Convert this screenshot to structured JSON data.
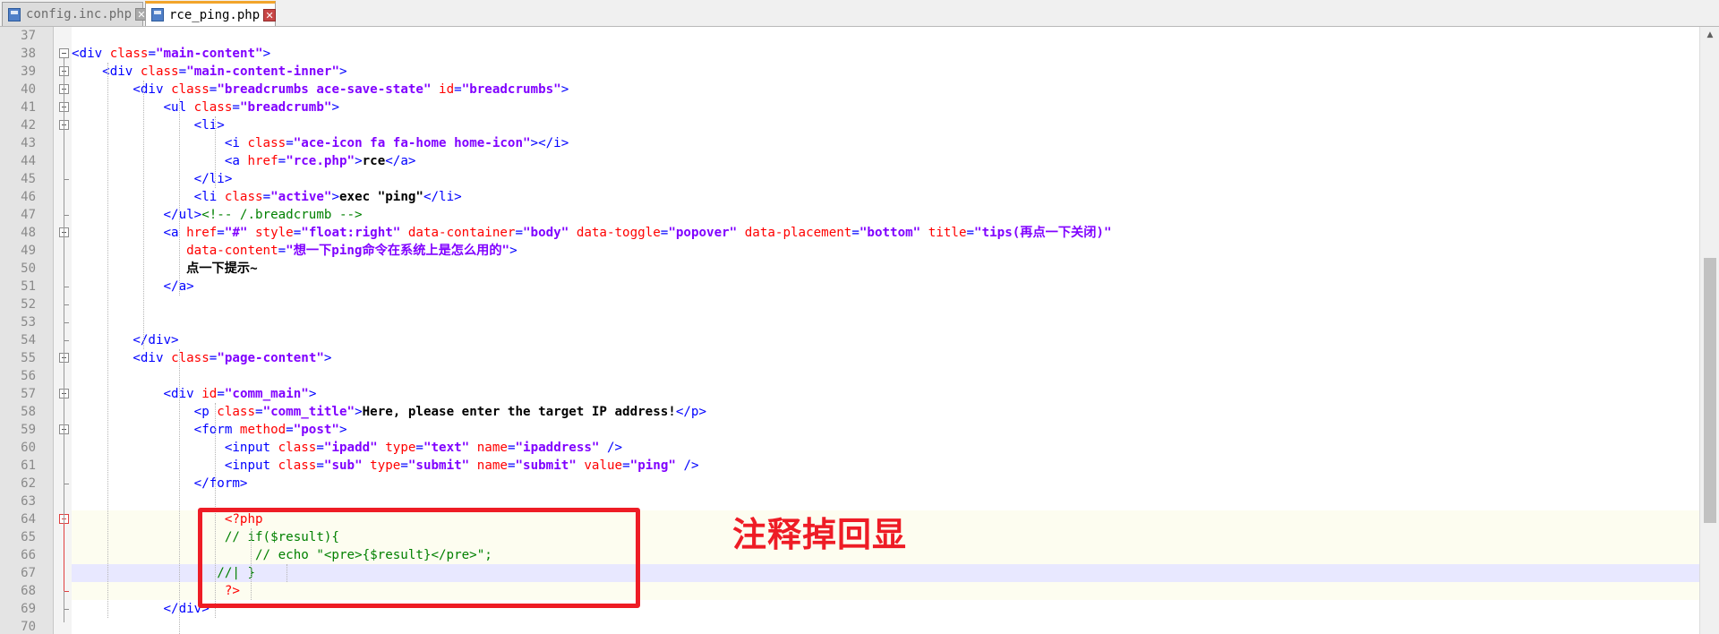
{
  "tabs": [
    {
      "label": "config.inc.php",
      "active": false
    },
    {
      "label": "rce_ping.php",
      "active": true
    }
  ],
  "editor": {
    "lines": [
      {
        "no": "37",
        "segs": []
      },
      {
        "no": "38",
        "segs": [
          [
            "tag",
            "<div "
          ],
          [
            "attr",
            "class"
          ],
          [
            "tag",
            "="
          ],
          [
            "val",
            "\"main-content\""
          ],
          [
            "tag",
            ">"
          ]
        ]
      },
      {
        "no": "39",
        "segs": [
          [
            "sp",
            "    "
          ],
          [
            "tag",
            "<div "
          ],
          [
            "attr",
            "class"
          ],
          [
            "tag",
            "="
          ],
          [
            "val",
            "\"main-content-inner\""
          ],
          [
            "tag",
            ">"
          ]
        ]
      },
      {
        "no": "40",
        "segs": [
          [
            "sp",
            "        "
          ],
          [
            "tag",
            "<div "
          ],
          [
            "attr",
            "class"
          ],
          [
            "tag",
            "="
          ],
          [
            "val",
            "\"breadcrumbs ace-save-state\""
          ],
          [
            "tag",
            " "
          ],
          [
            "attr",
            "id"
          ],
          [
            "tag",
            "="
          ],
          [
            "val",
            "\"breadcrumbs\""
          ],
          [
            "tag",
            ">"
          ]
        ]
      },
      {
        "no": "41",
        "segs": [
          [
            "sp",
            "            "
          ],
          [
            "tag",
            "<ul "
          ],
          [
            "attr",
            "class"
          ],
          [
            "tag",
            "="
          ],
          [
            "val",
            "\"breadcrumb\""
          ],
          [
            "tag",
            ">"
          ]
        ]
      },
      {
        "no": "42",
        "segs": [
          [
            "sp",
            "                "
          ],
          [
            "tag",
            "<li>"
          ]
        ]
      },
      {
        "no": "43",
        "segs": [
          [
            "sp",
            "                    "
          ],
          [
            "tag",
            "<i "
          ],
          [
            "attr",
            "class"
          ],
          [
            "tag",
            "="
          ],
          [
            "val",
            "\"ace-icon fa fa-home home-icon\""
          ],
          [
            "tag",
            "></i>"
          ]
        ]
      },
      {
        "no": "44",
        "segs": [
          [
            "sp",
            "                    "
          ],
          [
            "tag",
            "<a "
          ],
          [
            "attr",
            "href"
          ],
          [
            "tag",
            "="
          ],
          [
            "val",
            "\"rce.php\""
          ],
          [
            "tag",
            ">"
          ],
          [
            "txt",
            "rce"
          ],
          [
            "tag",
            "</a>"
          ]
        ]
      },
      {
        "no": "45",
        "segs": [
          [
            "sp",
            "                "
          ],
          [
            "tag",
            "</li>"
          ]
        ]
      },
      {
        "no": "46",
        "segs": [
          [
            "sp",
            "                "
          ],
          [
            "tag",
            "<li "
          ],
          [
            "attr",
            "class"
          ],
          [
            "tag",
            "="
          ],
          [
            "val",
            "\"active\""
          ],
          [
            "tag",
            ">"
          ],
          [
            "txt",
            "exec \"ping\""
          ],
          [
            "tag",
            "</li>"
          ]
        ]
      },
      {
        "no": "47",
        "segs": [
          [
            "sp",
            "            "
          ],
          [
            "tag",
            "</ul>"
          ],
          [
            "cmt",
            "<!-- /.breadcrumb -->"
          ]
        ]
      },
      {
        "no": "48",
        "segs": [
          [
            "sp",
            "            "
          ],
          [
            "tag",
            "<a "
          ],
          [
            "attr",
            "href"
          ],
          [
            "tag",
            "="
          ],
          [
            "val",
            "\"#\""
          ],
          [
            "tag",
            " "
          ],
          [
            "attr",
            "style"
          ],
          [
            "tag",
            "="
          ],
          [
            "val",
            "\"float:right\""
          ],
          [
            "tag",
            " "
          ],
          [
            "attr",
            "data-container"
          ],
          [
            "tag",
            "="
          ],
          [
            "val",
            "\"body\""
          ],
          [
            "tag",
            " "
          ],
          [
            "attr",
            "data-toggle"
          ],
          [
            "tag",
            "="
          ],
          [
            "val",
            "\"popover\""
          ],
          [
            "tag",
            " "
          ],
          [
            "attr",
            "data-placement"
          ],
          [
            "tag",
            "="
          ],
          [
            "val",
            "\"bottom\""
          ],
          [
            "tag",
            " "
          ],
          [
            "attr",
            "title"
          ],
          [
            "tag",
            "="
          ],
          [
            "val",
            "\"tips(再点一下关闭)\""
          ]
        ]
      },
      {
        "no": "49",
        "segs": [
          [
            "sp",
            "               "
          ],
          [
            "attr",
            "data-content"
          ],
          [
            "tag",
            "="
          ],
          [
            "val",
            "\"想一下ping命令在系统上是怎么用的\""
          ],
          [
            "tag",
            ">"
          ]
        ]
      },
      {
        "no": "50",
        "segs": [
          [
            "sp",
            "               "
          ],
          [
            "txt",
            "点一下提示~"
          ]
        ]
      },
      {
        "no": "51",
        "segs": [
          [
            "sp",
            "            "
          ],
          [
            "tag",
            "</a>"
          ]
        ]
      },
      {
        "no": "52",
        "segs": []
      },
      {
        "no": "53",
        "segs": []
      },
      {
        "no": "54",
        "segs": [
          [
            "sp",
            "        "
          ],
          [
            "tag",
            "</div>"
          ]
        ]
      },
      {
        "no": "55",
        "segs": [
          [
            "sp",
            "        "
          ],
          [
            "tag",
            "<div "
          ],
          [
            "attr",
            "class"
          ],
          [
            "tag",
            "="
          ],
          [
            "val",
            "\"page-content\""
          ],
          [
            "tag",
            ">"
          ]
        ]
      },
      {
        "no": "56",
        "segs": []
      },
      {
        "no": "57",
        "segs": [
          [
            "sp",
            "            "
          ],
          [
            "tag",
            "<div "
          ],
          [
            "attr",
            "id"
          ],
          [
            "tag",
            "="
          ],
          [
            "val",
            "\"comm_main\""
          ],
          [
            "tag",
            ">"
          ]
        ]
      },
      {
        "no": "58",
        "segs": [
          [
            "sp",
            "                "
          ],
          [
            "tag",
            "<p "
          ],
          [
            "attr",
            "class"
          ],
          [
            "tag",
            "="
          ],
          [
            "val",
            "\"comm_title\""
          ],
          [
            "tag",
            ">"
          ],
          [
            "txt",
            "Here, please enter the target IP address!"
          ],
          [
            "tag",
            "</p>"
          ]
        ]
      },
      {
        "no": "59",
        "segs": [
          [
            "sp",
            "                "
          ],
          [
            "tag",
            "<form "
          ],
          [
            "attr",
            "method"
          ],
          [
            "tag",
            "="
          ],
          [
            "val",
            "\"post\""
          ],
          [
            "tag",
            ">"
          ]
        ]
      },
      {
        "no": "60",
        "segs": [
          [
            "sp",
            "                    "
          ],
          [
            "tag",
            "<input "
          ],
          [
            "attr",
            "class"
          ],
          [
            "tag",
            "="
          ],
          [
            "val",
            "\"ipadd\""
          ],
          [
            "tag",
            " "
          ],
          [
            "attr",
            "type"
          ],
          [
            "tag",
            "="
          ],
          [
            "val",
            "\"text\""
          ],
          [
            "tag",
            " "
          ],
          [
            "attr",
            "name"
          ],
          [
            "tag",
            "="
          ],
          [
            "val",
            "\"ipaddress\""
          ],
          [
            "tag",
            " />"
          ]
        ]
      },
      {
        "no": "61",
        "segs": [
          [
            "sp",
            "                    "
          ],
          [
            "tag",
            "<input "
          ],
          [
            "attr",
            "class"
          ],
          [
            "tag",
            "="
          ],
          [
            "val",
            "\"sub\""
          ],
          [
            "tag",
            " "
          ],
          [
            "attr",
            "type"
          ],
          [
            "tag",
            "="
          ],
          [
            "val",
            "\"submit\""
          ],
          [
            "tag",
            " "
          ],
          [
            "attr",
            "name"
          ],
          [
            "tag",
            "="
          ],
          [
            "val",
            "\"submit\""
          ],
          [
            "tag",
            " "
          ],
          [
            "attr",
            "value"
          ],
          [
            "tag",
            "="
          ],
          [
            "val",
            "\"ping\""
          ],
          [
            "tag",
            " />"
          ]
        ]
      },
      {
        "no": "62",
        "segs": [
          [
            "sp",
            "                "
          ],
          [
            "tag",
            "</form>"
          ]
        ]
      },
      {
        "no": "63",
        "segs": []
      },
      {
        "no": "64",
        "segs": [
          [
            "sp",
            "                    "
          ],
          [
            "php",
            "<?php"
          ]
        ]
      },
      {
        "no": "65",
        "segs": [
          [
            "sp",
            "                    "
          ],
          [
            "phpcmt",
            "// if($result){"
          ]
        ]
      },
      {
        "no": "66",
        "segs": [
          [
            "sp",
            "                        "
          ],
          [
            "phpcmt",
            "// echo \"<pre>{$result}</pre>\";"
          ]
        ]
      },
      {
        "no": "67",
        "segs": [
          [
            "sp",
            "                   "
          ],
          [
            "phpcmt",
            "//| }"
          ]
        ]
      },
      {
        "no": "68",
        "segs": [
          [
            "sp",
            "                    "
          ],
          [
            "php",
            "?>"
          ]
        ]
      },
      {
        "no": "69",
        "segs": [
          [
            "sp",
            "            "
          ],
          [
            "tag",
            "</div>"
          ]
        ]
      },
      {
        "no": "70",
        "segs": []
      }
    ]
  },
  "annotation": {
    "text": "注释掉回显",
    "color": "#ee1c25"
  },
  "colors": {
    "tag": "#0000ff",
    "attr": "#ff0000",
    "value": "#8000ff",
    "comment": "#008000",
    "line_highlight": "#e8e8ff"
  }
}
